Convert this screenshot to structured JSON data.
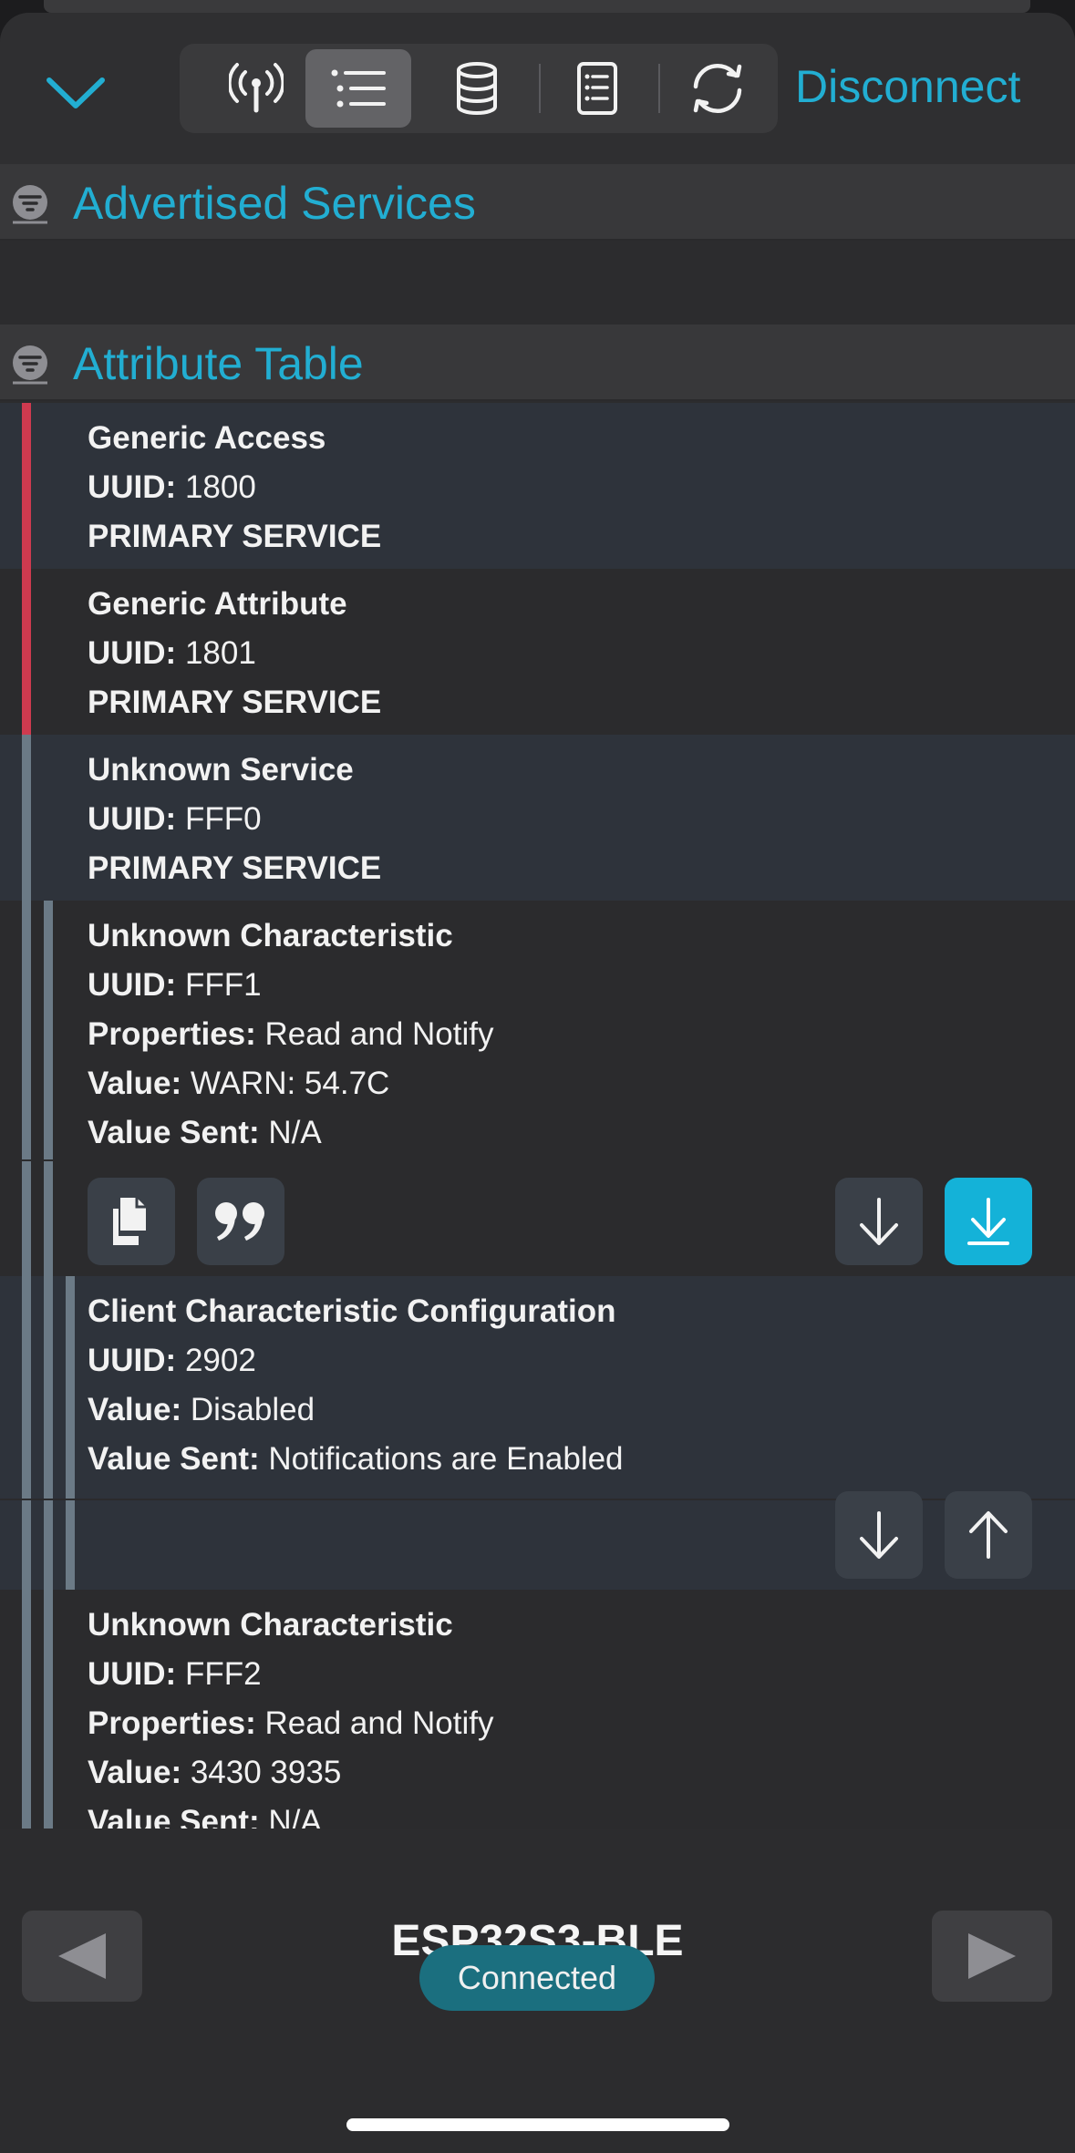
{
  "toolbar": {
    "disconnect_label": "Disconnect",
    "tabs": [
      {
        "icon": "antenna-icon",
        "active": false
      },
      {
        "icon": "list-icon",
        "active": true
      },
      {
        "icon": "database-icon",
        "active": false
      },
      {
        "icon": "document-icon",
        "active": false
      },
      {
        "icon": "refresh-icon",
        "active": false
      }
    ]
  },
  "sections": {
    "advertised_title": "Advertised Services",
    "attribute_title": "Attribute Table"
  },
  "labels": {
    "uuid": "UUID:",
    "properties": "Properties:",
    "value": "Value:",
    "value_sent": "Value Sent:"
  },
  "attributes": [
    {
      "title": "Generic Access",
      "uuid": "1800",
      "kind": "PRIMARY SERVICE"
    },
    {
      "title": "Generic Attribute",
      "uuid": "1801",
      "kind": "PRIMARY SERVICE"
    },
    {
      "title": "Unknown Service",
      "uuid": "FFF0",
      "kind": "PRIMARY SERVICE"
    },
    {
      "title": "Unknown Characteristic",
      "uuid": "FFF1",
      "properties": "Read and Notify",
      "value": "WARN: 54.7C",
      "value_sent": "N/A"
    },
    {
      "title": "Client Characteristic Configuration",
      "uuid": "2902",
      "value": "Disabled",
      "value_sent": "Notifications are Enabled"
    },
    {
      "title": "Unknown Characteristic",
      "uuid": "FFF2",
      "properties": "Read and Notify",
      "value": "3430 3935",
      "value_sent": "N/A"
    }
  ],
  "footer": {
    "device_name": "ESP32S3-BLE",
    "status": "Connected"
  },
  "colors": {
    "accent": "#22aed2",
    "service_bar": "#cf3a4f",
    "characteristic_bar": "#6b7a86",
    "notify_button": "#14b2d8",
    "status_pill": "#1b6f7f"
  }
}
